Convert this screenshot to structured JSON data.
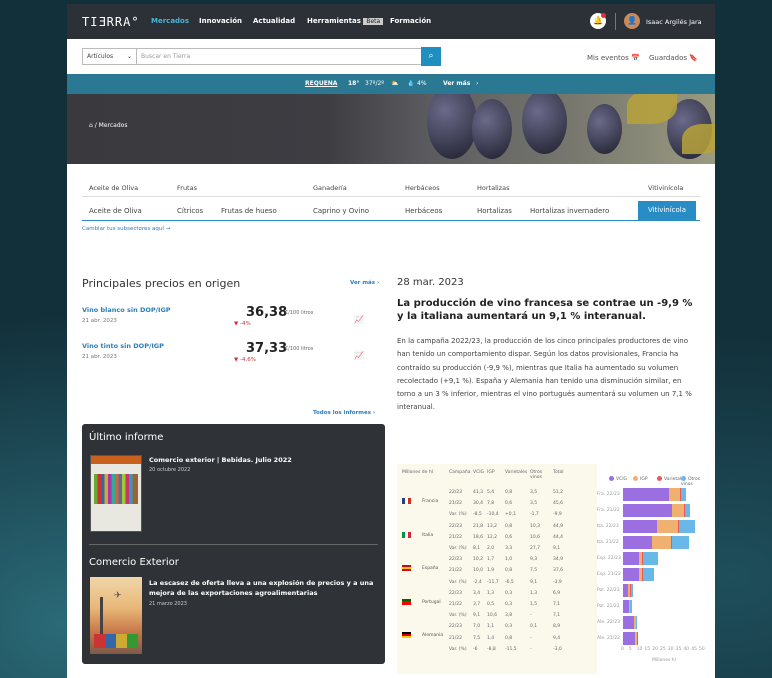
{
  "nav": {
    "logo": "TIƎRRA°",
    "items": [
      "Mercados",
      "Innovación",
      "Actualidad",
      "Herramientas",
      "Formación"
    ],
    "beta": "Beta",
    "user": "Isaac Argilés Jara"
  },
  "search": {
    "scope": "Artículos",
    "placeholder": "Buscar en Tierra",
    "events": "Mis eventos",
    "saved": "Guardados"
  },
  "weather": {
    "location": "REQUENA",
    "temp": "18°",
    "range": "37º/2º",
    "rain": "4%",
    "more": "Ver más"
  },
  "breadcrumb": "Mercados",
  "sectors": {
    "groups": [
      "Aceite de Oliva",
      "Frutas",
      "Ganadería",
      "Herbáceos",
      "Hortalizas",
      "Vitivinícola"
    ],
    "subs": [
      "Aceite de Oliva",
      "Cítricos",
      "Frutas de hueso",
      "Caprino y Ovino",
      "Herbáceos",
      "Hortalizas",
      "Hortalizas invernadero",
      "Vitivinícola"
    ],
    "change_link": "Cambiar tus subsectores aquí →"
  },
  "prices": {
    "title": "Principales precios en origen",
    "see_more": "Ver más ›",
    "items": [
      {
        "name": "Vino blanco sin DOP/IGP",
        "date": "21 abr. 2023",
        "value": "36,38",
        "unit": "€/100 litros",
        "change": "-4%"
      },
      {
        "name": "Vino tinto sin DOP/IGP",
        "date": "21 abr. 2023",
        "value": "37,33",
        "unit": "€/100 litros",
        "change": "-4,6%"
      }
    ],
    "all_reports": "Todos los informes ›"
  },
  "news": {
    "date": "28 mar. 2023",
    "title": "La producción de vino francesa se contrae un -9,9 % y la italiana aumentará un 9,1 % interanual.",
    "body": "En la campaña 2022/23, la producción de los cinco principales productores de vino han tenido un comportamiento dispar. Según los datos provisionales, Francia ha contraído su producción (-9,9 %), mientras que Italia ha aumentado su volumen recolectado (+9,1 %). España y Alemania han tenido una disminución similar, en torno a un 3 % inferior, mientras el vino portugués aumentará su volumen un 7,1 % interanual."
  },
  "latest_report": {
    "heading": "Último informe",
    "title": "Comercio exterior | Bebidas. Julio 2022",
    "date": "20 octubre 2022"
  },
  "foreign_trade": {
    "heading": "Comercio Exterior",
    "title": "La escasez de oferta lleva a una explosión de precios y a una mejora de las exportaciones agroalimentarias",
    "date": "21 marzo 2023"
  },
  "table": {
    "headers": [
      "Millones de hl",
      "Campaña",
      "VCIG",
      "IGP",
      "Varietales",
      "Otros vinos",
      "Total"
    ],
    "countries": [
      "Francia",
      "Italia",
      "España",
      "Portugal",
      "Alemania"
    ],
    "flag_colors": [
      [
        "#233e8b",
        "#ffffff",
        "#d52b1e"
      ],
      [
        "#009246",
        "#ffffff",
        "#ce2b37"
      ],
      [
        "#c60b1e",
        "#ffc400",
        "#c60b1e"
      ],
      [
        "#006600",
        "#ff0000",
        "#ff0000"
      ],
      [
        "#000000",
        "#dd0000",
        "#ffce00"
      ]
    ],
    "rows": [
      [
        "22/23",
        "41,3",
        "5,4",
        "0,8",
        "3,5",
        "51,2"
      ],
      [
        "21/22",
        "30,4",
        "7,8",
        "0,6",
        "3,5",
        "45,6"
      ],
      [
        "Var. (%)",
        "-8,5",
        "-10,4",
        "+0,1",
        "-1,7",
        "-9,9"
      ],
      [
        "22/23",
        "21,8",
        "13,2",
        "0,8",
        "10,3",
        "44,9"
      ],
      [
        "21/22",
        "18,6",
        "12,2",
        "0,6",
        "10,6",
        "44,4"
      ],
      [
        "Var. (%)",
        "8,1",
        "2,0",
        "3,3",
        "27,7",
        "9,1"
      ],
      [
        "22/23",
        "10,2",
        "1,7",
        "1,0",
        "9,3",
        "34,9"
      ],
      [
        "21/22",
        "10,0",
        "1,9",
        "0,8",
        "7,5",
        "37,6"
      ],
      [
        "Var. (%)",
        "-2,4",
        "-11,7",
        "-6,5",
        "9,1",
        "-3,9"
      ],
      [
        "22/23",
        "3,4",
        "1,3",
        "0,3",
        "1,3",
        "6,9"
      ],
      [
        "21/22",
        "3,7",
        "0,5",
        "0,3",
        "1,5",
        "7,1"
      ],
      [
        "Var. (%)",
        "9,1",
        "10,6",
        "3,8",
        "-",
        "7,1"
      ],
      [
        "22/23",
        "7,0",
        "1,1",
        "0,3",
        "0,1",
        "8,9"
      ],
      [
        "21/22",
        "7,5",
        "1,4",
        "0,8",
        "-",
        "9,4"
      ],
      [
        "Var. (%)",
        "-6",
        "-8,8",
        "-11,5",
        "-",
        "-3,0"
      ]
    ]
  },
  "chart_data": {
    "type": "bar",
    "orientation": "horizontal",
    "stacked": true,
    "categories": [
      "Fra. 22/23",
      "Fra. 21/22",
      "Ita. 22/23",
      "Ita. 21/22",
      "Esp. 22/23",
      "Esp. 21/22",
      "Por. 22/23",
      "Por. 21/22",
      "Ale. 22/23",
      "Ale. 21/22"
    ],
    "series": [
      {
        "name": "VCIG",
        "color": "#9b6fe0",
        "values": [
          29.4,
          31.1,
          21.8,
          18.6,
          10.2,
          10.0,
          3.4,
          3.7,
          7.0,
          7.5
        ]
      },
      {
        "name": "IGP",
        "color": "#f0b070",
        "values": [
          7.0,
          7.8,
          13.2,
          12.2,
          1.7,
          1.9,
          1.3,
          0.5,
          1.1,
          1.4
        ]
      },
      {
        "name": "Varietal",
        "color": "#e85a5a",
        "values": [
          0.8,
          0.6,
          0.8,
          0.6,
          1.0,
          0.8,
          0.3,
          0.3,
          0.3,
          0.8
        ]
      },
      {
        "name": "Otros vinos",
        "color": "#6ab8e8",
        "values": [
          3.5,
          3.5,
          10.3,
          10.6,
          9.3,
          7.5,
          1.3,
          1.5,
          0.1,
          0.0
        ]
      }
    ],
    "xlim": [
      0,
      50
    ],
    "xticks": [
      "0",
      "5",
      "10",
      "15",
      "20",
      "25",
      "30",
      "35",
      "40",
      "45",
      "50"
    ],
    "xlabel": "Millones hl",
    "legend": "top"
  }
}
